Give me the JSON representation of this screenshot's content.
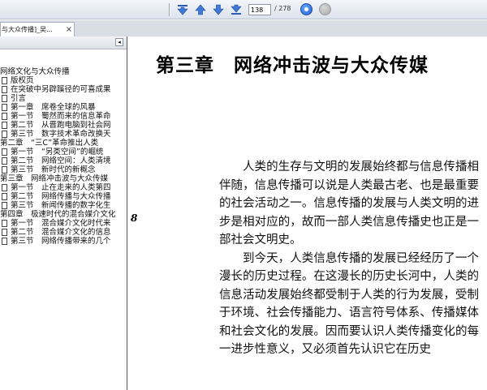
{
  "toolbar": {
    "first_page_icon": "first-page-icon",
    "prev_page_icon": "arrow-up-icon",
    "next_page_icon": "arrow-down-icon",
    "last_page_icon": "last-page-icon",
    "current_page": "138",
    "total_pages": "/ 278",
    "go_icon": "go-icon",
    "stop_icon": "stop-icon"
  },
  "tab": {
    "label": "与大众传播]_吴...",
    "close": "×"
  },
  "sidebar": {
    "collapse": "◂",
    "items": [
      {
        "label": "网络文化与大众传播",
        "icon": false
      },
      {
        "label": "版权页",
        "icon": true
      },
      {
        "label": "在突破中另辟蹊径的可喜成果",
        "icon": true
      },
      {
        "label": "引言",
        "icon": true
      },
      {
        "label": "第一章　席卷全球的风暴",
        "icon": true
      },
      {
        "label": "第一节　蜀然而来的信息革命",
        "icon": true
      },
      {
        "label": "第二节　从晋跑电脑到社会网",
        "icon": true
      },
      {
        "label": "第三节　数字技术革命改换天",
        "icon": true
      },
      {
        "label": "第二章　“三C”革命推出人类",
        "icon": false
      },
      {
        "label": "第一节　“另类空间”的崛统",
        "icon": true
      },
      {
        "label": "第二节　网络空间：人类清境",
        "icon": true
      },
      {
        "label": "第三节　新时代的新概念",
        "icon": true
      },
      {
        "label": "第三章　网络冲击波与大众传媒",
        "icon": false
      },
      {
        "label": "第一节　止在走来的人类第四",
        "icon": true
      },
      {
        "label": "第二节　网络传播与大众传播",
        "icon": true
      },
      {
        "label": "第三节　新闻传播的数字化生",
        "icon": true
      },
      {
        "label": "第四章　极速时代的混合媒介文化",
        "icon": false
      },
      {
        "label": "第一节　混合媒介文化时代来",
        "icon": true
      },
      {
        "label": "第二节　混合媒介文化的信息",
        "icon": true
      },
      {
        "label": "第三节　网络传播带来的几个",
        "icon": true
      }
    ]
  },
  "document": {
    "chapter_title": "第三章　网络冲击波与大众传媒",
    "paragraphs": [
      "人类的生存与文明的发展始终都与信息传播相伴随，信息传播可以说是人类最古老、也是最重要的社会活动之一。信息传播的发展与人类文明的进步是相对应的，故而一部人类信息传播史也正是一部社会文明史。",
      "到今天，人类信息传播的发展已经经历了一个漫长的历史过程。在这漫长的历史长河中，人类的信息活动发展始终都受制于人类的行为发展，受制于环境、社会传播能力、语言符号体系、传播媒体和社会文化的发展。因而要认识人类传播变化的每一进步性意义，又必须首先认识它在历史"
    ],
    "cursor_mark": "8"
  },
  "colors": {
    "toolbar_bg": "#dde3ec",
    "tab_strip_bg": "#d9dde4",
    "go_button": "#1f5fd0"
  }
}
